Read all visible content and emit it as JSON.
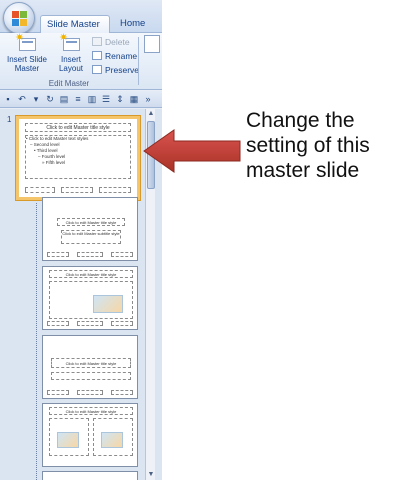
{
  "tabs": [
    {
      "label": "Slide Master"
    },
    {
      "label": "Home"
    }
  ],
  "ribbon": {
    "insert_slide_master": "Insert Slide Master",
    "insert_layout": "Insert Layout",
    "delete": "Delete",
    "rename": "Rename",
    "preserve": "Preserve",
    "group_label": "Edit Master"
  },
  "master_slide": {
    "number": "1",
    "title": "Click to edit Master title style",
    "body_lines": [
      "• Click to edit Master text styles",
      "– Second level",
      "• Third level",
      "– Fourth level",
      "» Fifth level"
    ]
  },
  "layouts": [
    {
      "title": "Click to edit Master title style",
      "subtitle": "Click to edit Master subtitle style"
    },
    {
      "title": "Click to edit Master title style"
    },
    {
      "title": "Click to edit Master title style"
    },
    {
      "title": "Click to edit Master title style"
    }
  ],
  "annotation": {
    "text": "Change the setting of this master slide",
    "arrow_color": "#c0392b"
  },
  "colors": {
    "accent": "#15428b",
    "selection_border": "#f4c56b"
  }
}
